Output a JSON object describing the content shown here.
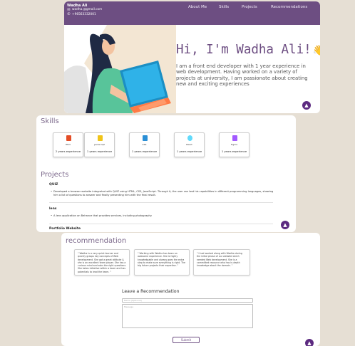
{
  "header": {
    "name": "Wadha Ali",
    "email": "wadha.@gmail.com",
    "phone": "+96563332001",
    "nav": [
      "About Me",
      "Skills",
      "Projects",
      "Recommendations"
    ]
  },
  "hero": {
    "title": "Hi, I'm Wadha Ali!",
    "wave_emoji": "👋",
    "text": "I am a front end developer with 1 year experience in web development. Having worked on a variety of projects at university, I am passionate about creating new and exciting experiences"
  },
  "skills": {
    "title": "Skills",
    "items": [
      {
        "name": "Html",
        "exp": "2 years experience",
        "icon": "html5-icon",
        "color": "#e44d26"
      },
      {
        "name": "Javascript",
        "exp": "1 years experience",
        "icon": "javascript-icon",
        "color": "#f0c419"
      },
      {
        "name": "CSS",
        "exp": "1 years experience",
        "icon": "css3-icon",
        "color": "#2a8fd6"
      },
      {
        "name": "React",
        "exp": "1 years experience",
        "icon": "react-icon",
        "color": "#61dafb"
      },
      {
        "name": "Figma",
        "exp": "1 years experience",
        "icon": "figma-icon",
        "color": "#a259ff"
      }
    ]
  },
  "projects": {
    "title": "Projects",
    "items": [
      {
        "name": "QUIZ",
        "desc": "Developed a browser website integrated with QUIZ using HTML, CSS, JavaScript. Through it, the user can test his capabilities in different programming languages, showing him a list of questions to answer and finally presenting him with the final result."
      },
      {
        "name": "lens",
        "desc": "A lens application on Behance that provides services, including photography"
      },
      {
        "name": "Portfolio Website",
        "desc": ""
      }
    ]
  },
  "recommendations": {
    "title": "recommendation",
    "items": [
      "\" Wadha is a very quick learner and quickly grasps key concepts of Web development. She got a great attitude & she is an excellent team player. She has a curious mind and asks the right questions. She takes initiative within a team and has potentials to lead the team. \"",
      "\" Working with Wadha has been an awesome experience. She is highly knowledgable and always goes the extra step to make sure everything is right. The big future projects their expertise. \"",
      "\" I had worked along with Wadha during the initial phase of our website which needed Web development. She is a committed resource who has in-depth knowledge about the domain. \""
    ],
    "form_title": "Leave a Recommendation",
    "name_placeholder": "Name (Optional)",
    "message_placeholder": "Message",
    "submit": "Submit"
  },
  "colors": {
    "primary": "#6d4e82",
    "fab": "#5c2a80",
    "page_bg": "#e6dfd4"
  }
}
